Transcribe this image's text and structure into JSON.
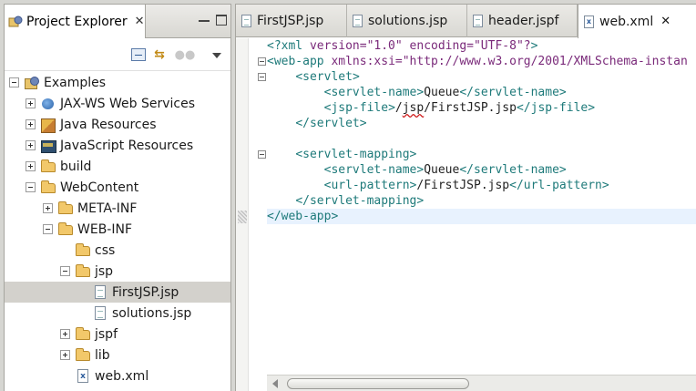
{
  "explorer": {
    "title": "Project Explorer",
    "tree": [
      {
        "label": "Examples",
        "icon": "project-icon",
        "toggle": "minus",
        "depth": 0
      },
      {
        "label": "JAX-WS Web Services",
        "icon": "jaxws-icon",
        "toggle": "plus",
        "depth": 1
      },
      {
        "label": "Java Resources",
        "icon": "java-resources-icon",
        "toggle": "plus",
        "depth": 1
      },
      {
        "label": "JavaScript Resources",
        "icon": "javascript-resources-icon",
        "toggle": "plus",
        "depth": 1
      },
      {
        "label": "build",
        "icon": "folder-icon",
        "toggle": "plus",
        "depth": 1
      },
      {
        "label": "WebContent",
        "icon": "folder-icon",
        "toggle": "minus",
        "depth": 1
      },
      {
        "label": "META-INF",
        "icon": "folder-icon",
        "toggle": "plus",
        "depth": 2
      },
      {
        "label": "WEB-INF",
        "icon": "folder-icon",
        "toggle": "minus",
        "depth": 2
      },
      {
        "label": "css",
        "icon": "folder-icon",
        "toggle": "none",
        "depth": 3
      },
      {
        "label": "jsp",
        "icon": "folder-icon",
        "toggle": "minus",
        "depth": 3
      },
      {
        "label": "FirstJSP.jsp",
        "icon": "file-icon",
        "toggle": "none",
        "depth": 4,
        "selected": true
      },
      {
        "label": "solutions.jsp",
        "icon": "file-icon",
        "toggle": "none",
        "depth": 4
      },
      {
        "label": "jspf",
        "icon": "folder-icon",
        "toggle": "plus",
        "depth": 3
      },
      {
        "label": "lib",
        "icon": "folder-icon",
        "toggle": "plus",
        "depth": 3
      },
      {
        "label": "web.xml",
        "icon": "xml-file-icon",
        "toggle": "none",
        "depth": 3
      }
    ]
  },
  "editor": {
    "tabs": [
      {
        "label": "FirstJSP.jsp",
        "icon": "file-icon"
      },
      {
        "label": "solutions.jsp",
        "icon": "file-icon"
      },
      {
        "label": "header.jspf",
        "icon": "file-icon"
      },
      {
        "label": "web.xml",
        "icon": "xml-file-icon",
        "active": true
      }
    ],
    "lines": [
      "<?xml version=\"1.0\" encoding=\"UTF-8\"?>",
      "<web-app xmlns:xsi=\"http://www.w3.org/2001/XMLSchema-instan",
      "    <servlet>",
      "        <servlet-name>Queue</servlet-name>",
      "        <jsp-file>/jsp/FirstJSP.jsp</jsp-file>",
      "    </servlet>",
      "",
      "    <servlet-mapping>",
      "        <servlet-name>Queue</servlet-name>",
      "        <url-pattern>/FirstJSP.jsp</url-pattern>",
      "    </servlet-mapping>",
      "</web-app>"
    ]
  },
  "colors": {
    "selection": "#d3d1cc",
    "xml_tag": "#1e7a7a",
    "xml_attr": "#7a2a7a",
    "xml_string": "#2a00d8"
  }
}
